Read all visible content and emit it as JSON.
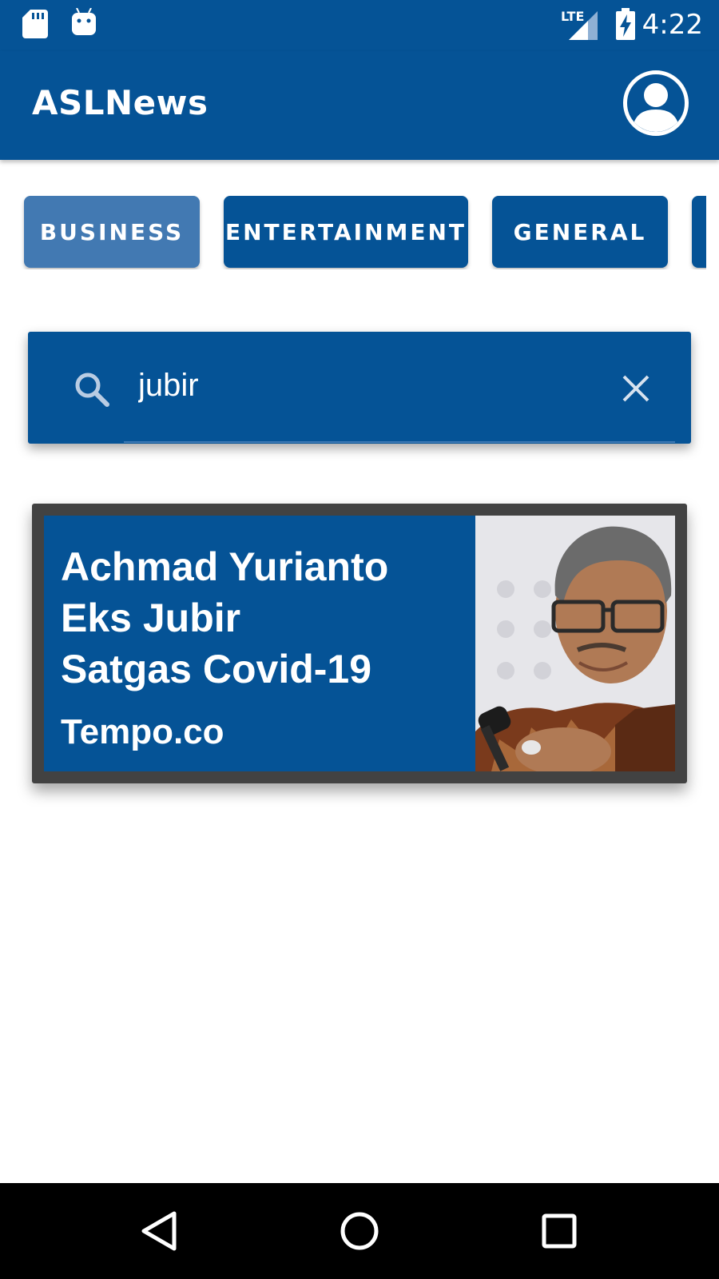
{
  "status_bar": {
    "time": "4:22",
    "network": "LTE",
    "icons": [
      "sd-card-icon",
      "android-icon",
      "signal-icon",
      "battery-charging-icon"
    ]
  },
  "app_bar": {
    "title": "ASLNews",
    "avatar_icon": "account-circle-icon"
  },
  "categories": {
    "items": [
      {
        "label": "BUSINESS",
        "selected": true
      },
      {
        "label": "ENTERTAINMENT",
        "selected": false
      },
      {
        "label": "GENERAL",
        "selected": false
      }
    ]
  },
  "search": {
    "value": "jubir",
    "search_icon": "search-icon",
    "clear_icon": "close-icon"
  },
  "articles": [
    {
      "title": "Achmad Yurianto\nEks Jubir\nSatgas Covid-19",
      "source": "Tempo.co"
    }
  ],
  "nav_bar": {
    "buttons": [
      "back-icon",
      "home-icon",
      "recents-icon"
    ]
  },
  "colors": {
    "primary": "#055396",
    "chip_selected": "#4279b2",
    "card_frame": "#424242"
  }
}
